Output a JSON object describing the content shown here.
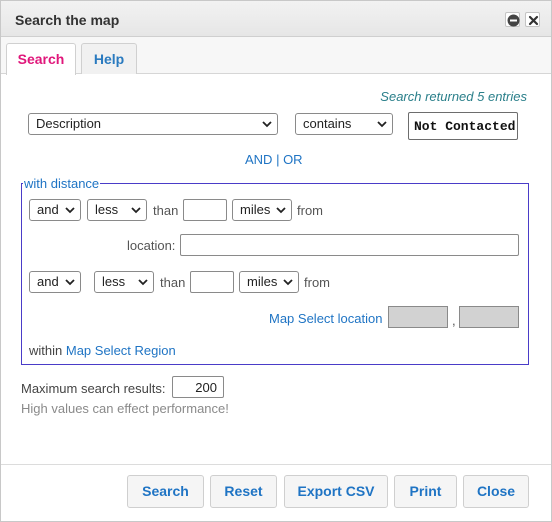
{
  "window": {
    "title": "Search the map"
  },
  "tabs": [
    {
      "label": "Search",
      "active": true
    },
    {
      "label": "Help",
      "active": false
    }
  ],
  "status": {
    "text": "Search returned 5 entries"
  },
  "criteria": {
    "field_select": "Description",
    "operator_select": "contains",
    "value": "Not Contacted"
  },
  "logic": {
    "and": "AND",
    "separator": " | ",
    "or": "OR"
  },
  "distance": {
    "legend": "with distance",
    "row1": {
      "conj": "and",
      "comparator": "less",
      "than": "than",
      "value": "",
      "unit": "miles",
      "from": "from"
    },
    "location_label": "location:",
    "location_value": "",
    "row2": {
      "conj": "and",
      "comparator": "less",
      "than": "than",
      "value": "",
      "unit": "miles",
      "from": "from"
    },
    "map_select_location": "Map Select location",
    "coord_sep": ",",
    "within": "within",
    "map_select_region": "Map Select Region"
  },
  "max_results": {
    "label": "Maximum search results:",
    "value": "200",
    "note": "High values can effect performance!"
  },
  "buttons": {
    "search": "Search",
    "reset": "Reset",
    "export_csv": "Export CSV",
    "print": "Print",
    "close": "Close"
  },
  "colors": {
    "active_tab": "#e0177b",
    "link": "#1f74c4",
    "status": "#2a7f8a",
    "fieldset_border": "#4a3cc8"
  }
}
